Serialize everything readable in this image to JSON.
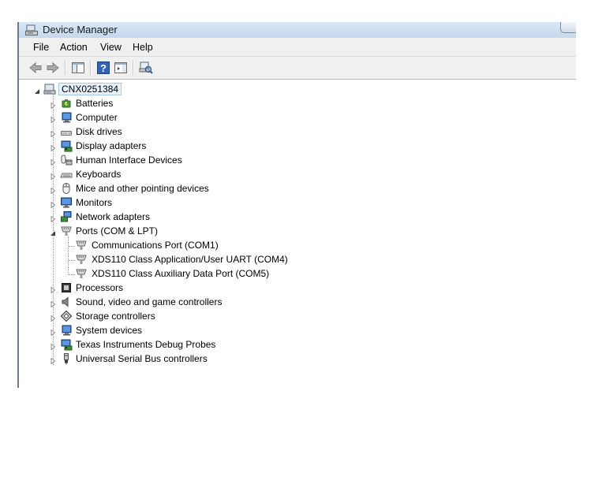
{
  "window": {
    "title": "Device Manager"
  },
  "menu": [
    {
      "label": "File"
    },
    {
      "label": "Action"
    },
    {
      "label": "View"
    },
    {
      "label": "Help"
    }
  ],
  "toolbar": {
    "buttons": [
      "back-arrow-icon",
      "forward-arrow-icon",
      "show-hide-console-tree-icon",
      "help-icon",
      "properties-pane-icon",
      "scan-hardware-icon"
    ]
  },
  "tree": {
    "root": {
      "label": "CNX0251384",
      "icon": "computer-icon",
      "expanded": true
    },
    "categories": [
      {
        "label": "Batteries",
        "icon": "battery-icon",
        "expanded": false
      },
      {
        "label": "Computer",
        "icon": "computer-icon",
        "expanded": false
      },
      {
        "label": "Disk drives",
        "icon": "disk-drive-icon",
        "expanded": false
      },
      {
        "label": "Display adapters",
        "icon": "display-adapter-icon",
        "expanded": false
      },
      {
        "label": "Human Interface Devices",
        "icon": "hid-icon",
        "expanded": false
      },
      {
        "label": "Keyboards",
        "icon": "keyboard-icon",
        "expanded": false
      },
      {
        "label": "Mice and other pointing devices",
        "icon": "mouse-icon",
        "expanded": false
      },
      {
        "label": "Monitors",
        "icon": "monitor-icon",
        "expanded": false
      },
      {
        "label": "Network adapters",
        "icon": "network-adapter-icon",
        "expanded": false
      },
      {
        "label": "Ports (COM & LPT)",
        "icon": "port-icon",
        "expanded": true,
        "children": [
          {
            "label": "Communications Port (COM1)",
            "icon": "port-icon"
          },
          {
            "label": "XDS110 Class Application/User UART (COM4)",
            "icon": "port-icon"
          },
          {
            "label": "XDS110 Class Auxiliary Data Port (COM5)",
            "icon": "port-icon"
          }
        ]
      },
      {
        "label": "Processors",
        "icon": "processor-icon",
        "expanded": false
      },
      {
        "label": "Sound, video and game controllers",
        "icon": "speaker-icon",
        "expanded": false
      },
      {
        "label": "Storage controllers",
        "icon": "storage-controller-icon",
        "expanded": false
      },
      {
        "label": "System devices",
        "icon": "system-device-icon",
        "expanded": false
      },
      {
        "label": "Texas Instruments Debug Probes",
        "icon": "debug-probe-icon",
        "expanded": false
      },
      {
        "label": "Universal Serial Bus controllers",
        "icon": "usb-icon",
        "expanded": false
      }
    ]
  }
}
